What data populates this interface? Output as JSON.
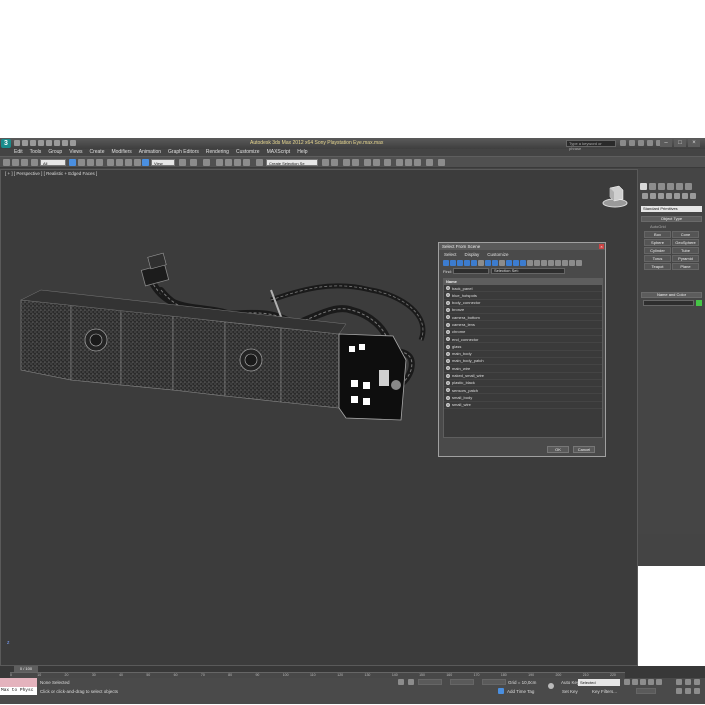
{
  "app": {
    "title": "Autodesk 3ds Max 2012 x64    Sony Playstation Eye.max.max",
    "logo_letter": "3",
    "search_placeholder": "Type a keyword or phrase",
    "window_controls": [
      "–",
      "□",
      "×"
    ]
  },
  "menu": [
    "Edit",
    "Tools",
    "Group",
    "Views",
    "Create",
    "Modifiers",
    "Animation",
    "Graph Editors",
    "Rendering",
    "Customize",
    "MAXScript",
    "Help"
  ],
  "toolbar": {
    "filter_dropdown": "All",
    "view_dropdown": "View",
    "selection_set_dropdown": "Create Selection Se"
  },
  "viewport": {
    "label": "[ + ] [ Perspective ] [ Realistic + Edged Faces ]",
    "axis_label": "z"
  },
  "command_panel": {
    "category_dropdown": "Standard Primitives",
    "object_type_title": "Object Type",
    "autogrid_label": "AutoGrid",
    "primitives": [
      "Box",
      "Cone",
      "Sphere",
      "GeoSphere",
      "Cylinder",
      "Tube",
      "Torus",
      "Pyramid",
      "Teapot",
      "Plane"
    ],
    "name_color_title": "Name and Color",
    "object_color": "#45c445"
  },
  "dialog": {
    "title": "Select From Scene",
    "close_label": "×",
    "tabs": [
      "Select",
      "Display",
      "Customize"
    ],
    "find_label": "Find:",
    "selection_set_label": "Selection Set:",
    "column_header": "Name",
    "items": [
      "back_panel",
      "blue_hotspots",
      "body_connector",
      "bronze",
      "camera_bottom",
      "camera_lens",
      "chrome",
      "end_connector",
      "glass",
      "main_body",
      "main_body_patch",
      "main_wire",
      "naked_small_wire",
      "plastic_black",
      "sensors_patch",
      "small_body",
      "small_wire"
    ],
    "ok_label": "OK",
    "cancel_label": "Cancel"
  },
  "timeline": {
    "frame_counter": "0 / 100",
    "ticks": [
      "0",
      "10",
      "20",
      "30",
      "40",
      "50",
      "60",
      "70",
      "80",
      "90",
      "100",
      "110",
      "120",
      "130",
      "140",
      "150",
      "160",
      "170",
      "180",
      "190",
      "200",
      "210",
      "220"
    ]
  },
  "status": {
    "maxscript_text": "Max to Physc",
    "selection_text": "None Selected",
    "prompt_text": "Click or click-and-drag to select objects",
    "grid_text": "Grid = 10,0cm",
    "add_time_tag": "Add Time Tag",
    "auto_key_label": "Auto Key",
    "set_key_label": "Set Key",
    "selected_dropdown": "Selected",
    "key_filters_label": "Key Filters..."
  }
}
